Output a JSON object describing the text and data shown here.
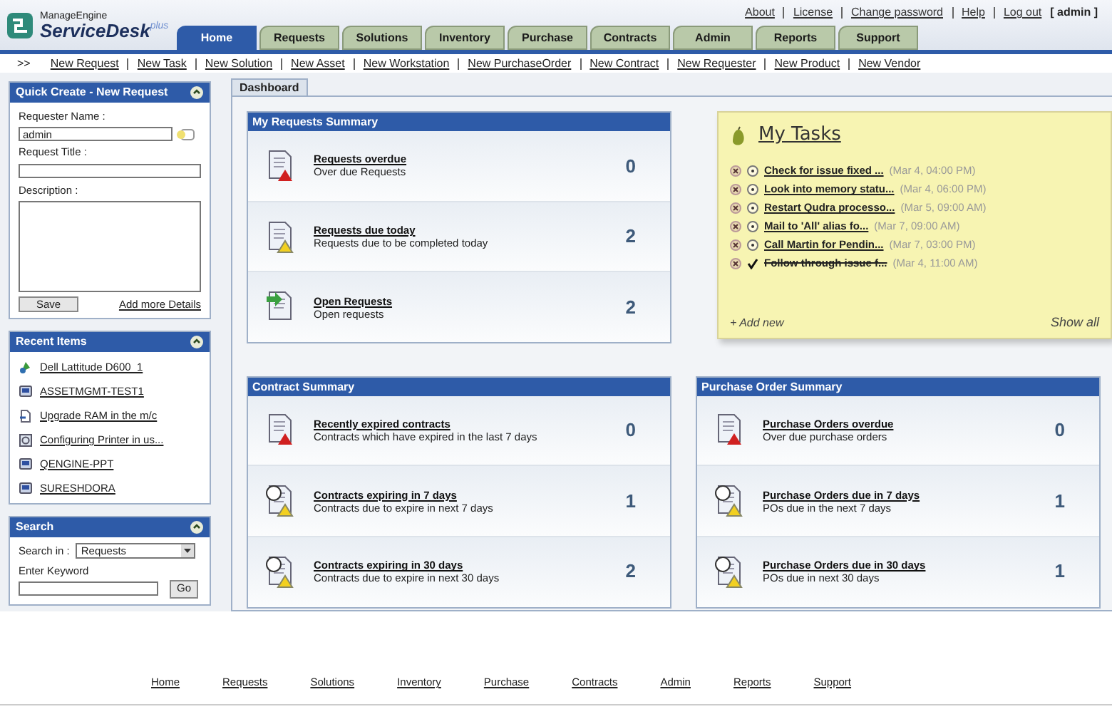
{
  "header": {
    "logo_small": "ManageEngine",
    "logo_large": "ServiceDesk",
    "logo_sup": "plus",
    "top_links": [
      "About",
      "License",
      "Change password",
      "Help",
      "Log out"
    ],
    "user": "[ admin ]"
  },
  "tabs": [
    {
      "label": "Home",
      "selected": true
    },
    {
      "label": "Requests",
      "selected": false
    },
    {
      "label": "Solutions",
      "selected": false
    },
    {
      "label": "Inventory",
      "selected": false
    },
    {
      "label": "Purchase",
      "selected": false
    },
    {
      "label": "Contracts",
      "selected": false
    },
    {
      "label": "Admin",
      "selected": false
    },
    {
      "label": "Reports",
      "selected": false
    },
    {
      "label": "Support",
      "selected": false
    }
  ],
  "quick_links": {
    "marker": ">>",
    "items": [
      "New Request",
      "New Task",
      "New Solution",
      "New Asset",
      "New Workstation",
      "New PurchaseOrder",
      "New Contract",
      "New Requester",
      "New Product",
      "New Vendor"
    ]
  },
  "quick_create": {
    "title": "Quick Create - New Request",
    "requester_label": "Requester Name :",
    "requester_value": "admin",
    "title_label": "Request Title :",
    "description_label": "Description :",
    "save": "Save",
    "more": "Add more Details"
  },
  "recent_items": {
    "title": "Recent Items",
    "items": [
      {
        "label": "Dell Lattitude D600_1",
        "kind": "asset"
      },
      {
        "label": "ASSETMGMT-TEST1",
        "kind": "workstation"
      },
      {
        "label": "Upgrade RAM in the m/c",
        "kind": "request"
      },
      {
        "label": "Configuring Printer in us...",
        "kind": "solution"
      },
      {
        "label": "QENGINE-PPT",
        "kind": "workstation"
      },
      {
        "label": "SURESHDORA",
        "kind": "workstation"
      }
    ]
  },
  "search": {
    "title": "Search",
    "search_in_label": "Search in :",
    "search_in_value": "Requests",
    "keyword_label": "Enter Keyword",
    "go": "Go"
  },
  "dashboard_tab": "Dashboard",
  "requests_summary": {
    "title": "My Requests Summary",
    "rows": [
      {
        "title": "Requests overdue",
        "subtitle": "Over due Requests",
        "count": "0",
        "kind": "overdue"
      },
      {
        "title": "Requests due today",
        "subtitle": "Requests due to be completed today",
        "count": "2",
        "kind": "due"
      },
      {
        "title": "Open Requests",
        "subtitle": "Open requests",
        "count": "2",
        "kind": "open"
      }
    ]
  },
  "my_tasks": {
    "title": "My Tasks",
    "tasks": [
      {
        "label": "Check for issue fixed ...",
        "time": "(Mar 4, 04:00 PM)",
        "done": false
      },
      {
        "label": "Look into memory statu...",
        "time": "(Mar 4, 06:00 PM)",
        "done": false
      },
      {
        "label": "Restart Qudra processo...",
        "time": "(Mar 5, 09:00 AM)",
        "done": false
      },
      {
        "label": "Mail to 'All' alias fo...",
        "time": "(Mar 7, 09:00 AM)",
        "done": false
      },
      {
        "label": "Call Martin for Pendin...",
        "time": "(Mar 7, 03:00 PM)",
        "done": false
      },
      {
        "label": "Follow through issue f...",
        "time": "(Mar 4, 11:00 AM)",
        "done": true
      }
    ],
    "add_new": "+ Add new",
    "show_all": "Show all"
  },
  "contract_summary": {
    "title": "Contract Summary",
    "rows": [
      {
        "title": "Recently expired contracts",
        "subtitle": "Contracts which have expired in the last 7 days",
        "count": "0",
        "kind": "overdue"
      },
      {
        "title": "Contracts expiring in 7 days",
        "subtitle": "Contracts due to expire in next 7 days",
        "count": "1",
        "kind": "due7"
      },
      {
        "title": "Contracts expiring in 30 days",
        "subtitle": "Contracts due to expire in next 30 days",
        "count": "2",
        "kind": "due30"
      }
    ]
  },
  "purchase_order_summary": {
    "title": "Purchase Order Summary",
    "rows": [
      {
        "title": "Purchase Orders overdue",
        "subtitle": "Over due purchase orders",
        "count": "0",
        "kind": "overdue"
      },
      {
        "title": "Purchase Orders due in 7 days",
        "subtitle": "POs due in the next 7 days",
        "count": "1",
        "kind": "due7"
      },
      {
        "title": "Purchase Orders due in 30 days",
        "subtitle": "POs due in next 30 days",
        "count": "1",
        "kind": "due30"
      }
    ]
  },
  "footer_links": [
    "Home",
    "Requests",
    "Solutions",
    "Inventory",
    "Purchase",
    "Contracts",
    "Admin",
    "Reports",
    "Support"
  ]
}
